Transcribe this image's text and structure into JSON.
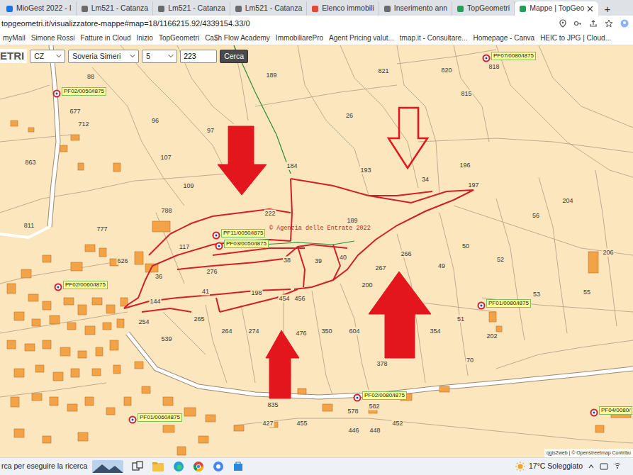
{
  "browser": {
    "tabs": [
      {
        "label": "MioGest 2022 - I",
        "selected": false
      },
      {
        "label": "Lm521 - Catanza",
        "selected": false
      },
      {
        "label": "Lm521 - Catanza",
        "selected": false
      },
      {
        "label": "Lm521 - Catanza",
        "selected": false
      },
      {
        "label": "Elenco immobili",
        "selected": false
      },
      {
        "label": "Inserimento ann",
        "selected": false
      },
      {
        "label": "TopGeometri",
        "selected": false
      },
      {
        "label": "Mappe | TopGeo",
        "selected": true
      }
    ],
    "new_tab": "+",
    "address": "topgeometri.it/visualizzatore-mappe#map=18/1166215.92/4339154.33/0",
    "bookmarks": [
      "myMail",
      "Simone Rossi",
      "Fatture in Cloud",
      "Inizio",
      "TopGeometri",
      "Ca$h Flow Academy",
      "ImmobiliarePro",
      "Agent Pricing valut...",
      "tmap.it - Consultare...",
      "Homepage - Canva",
      "HEIC to JPG | Cloud..."
    ]
  },
  "map_toolbar": {
    "logo": "ETRI",
    "province": "CZ",
    "municipality": "Soveria Simeri",
    "sheet": "5",
    "parcel": "223",
    "search_button": "Cerca"
  },
  "map": {
    "parcels": [
      "189",
      "821",
      "820",
      "88",
      "677",
      "712",
      "96",
      "26",
      "815",
      "863",
      "97",
      "107",
      "184",
      "193",
      "34",
      "196",
      "197",
      "109",
      "788",
      "222",
      "189",
      "204",
      "56",
      "777",
      "811",
      "117",
      "50",
      "52",
      "266",
      "276",
      "38",
      "39",
      "40",
      "267",
      "49",
      "41",
      "198",
      "200",
      "144",
      "265",
      "454",
      "456",
      "51",
      "264",
      "274",
      "476",
      "350",
      "604",
      "354",
      "202",
      "70",
      "378",
      "578",
      "582",
      "452",
      "835",
      "427",
      "455",
      "446",
      "448",
      "206",
      "53",
      "55",
      "818",
      "539",
      "626",
      "36",
      "254"
    ],
    "markers": [
      "PF02/0050/I875",
      "PF07/0080/I875",
      "PF11/0050/I875",
      "PF03/0050/I875",
      "PF02/0060/I875",
      "PF01/0080/I875",
      "PF02/0080/I875",
      "PF01/0060/I875",
      "PF04/0080/"
    ],
    "arrows": [
      {
        "filled": true
      },
      {
        "filled": false
      },
      {
        "filled": true
      },
      {
        "filled": true
      }
    ],
    "watermark": "© Agenzia delle Entrate 2022",
    "attribution": "qgis2web | © Openstreetmap Contribu"
  },
  "taskbar": {
    "search": "rca per eseguire la ricerca",
    "weather": "17°C Soleggiato"
  }
}
